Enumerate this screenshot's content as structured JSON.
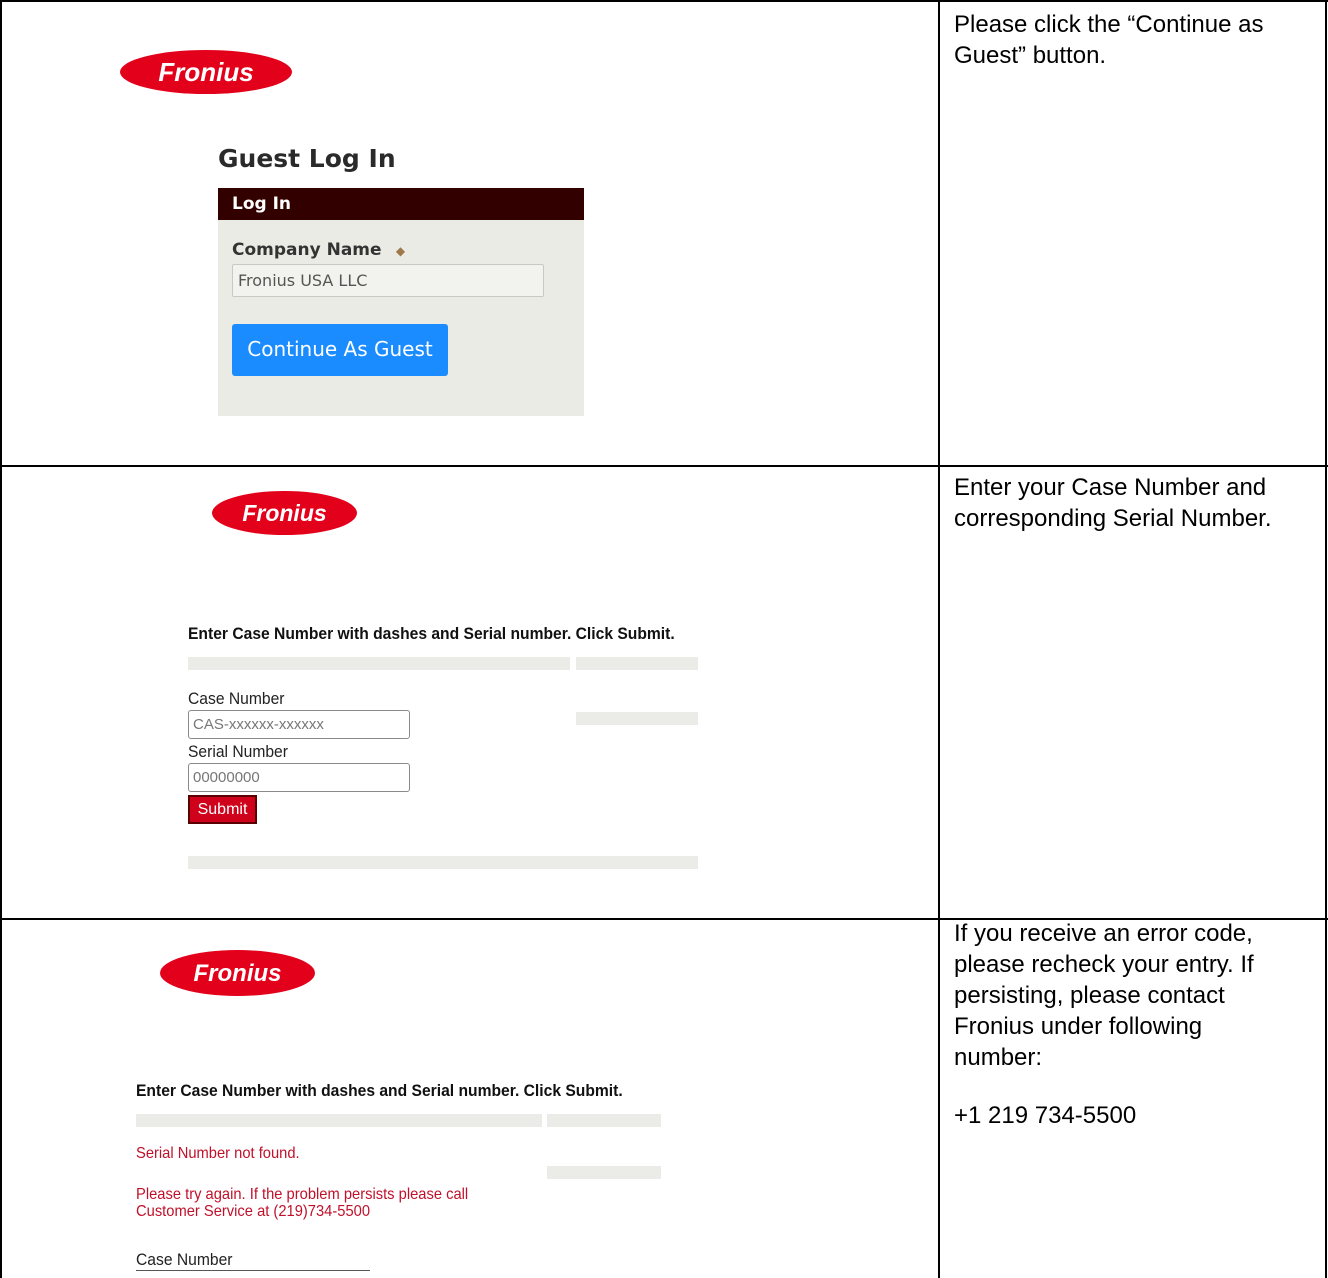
{
  "brand": {
    "logo_text": "Fronius",
    "logo_color": "#e3001b"
  },
  "rows": [
    {
      "instruction": "Please click the “Continue as Guest” button.",
      "screenshot": {
        "title": "Guest Log In",
        "panel_header": "Log In",
        "field_label": "Company Name",
        "field_value": "Fronius USA LLC",
        "button_label": "Continue As Guest"
      }
    },
    {
      "instruction": "Enter your Case Number and corresponding Serial Number.",
      "screenshot": {
        "heading": "Enter Case Number with dashes and Serial number. Click Submit.",
        "case_label": "Case Number",
        "case_placeholder": "CAS-xxxxxx-xxxxxx",
        "serial_label": "Serial Number",
        "serial_placeholder": "00000000",
        "submit_label": "Submit"
      }
    },
    {
      "instruction": "If you receive an error code, please recheck your entry. If persisting, please contact Fronius under following number:",
      "phone": "+1 219 734-5500",
      "screenshot": {
        "heading": "Enter Case Number with dashes and Serial number. Click Submit.",
        "error_1": "Serial Number not found.",
        "error_2_line1": "Please try again. If the problem persists please call",
        "error_2_line2": "Customer Service at (219)734-5500",
        "case_label": "Case Number"
      }
    }
  ]
}
